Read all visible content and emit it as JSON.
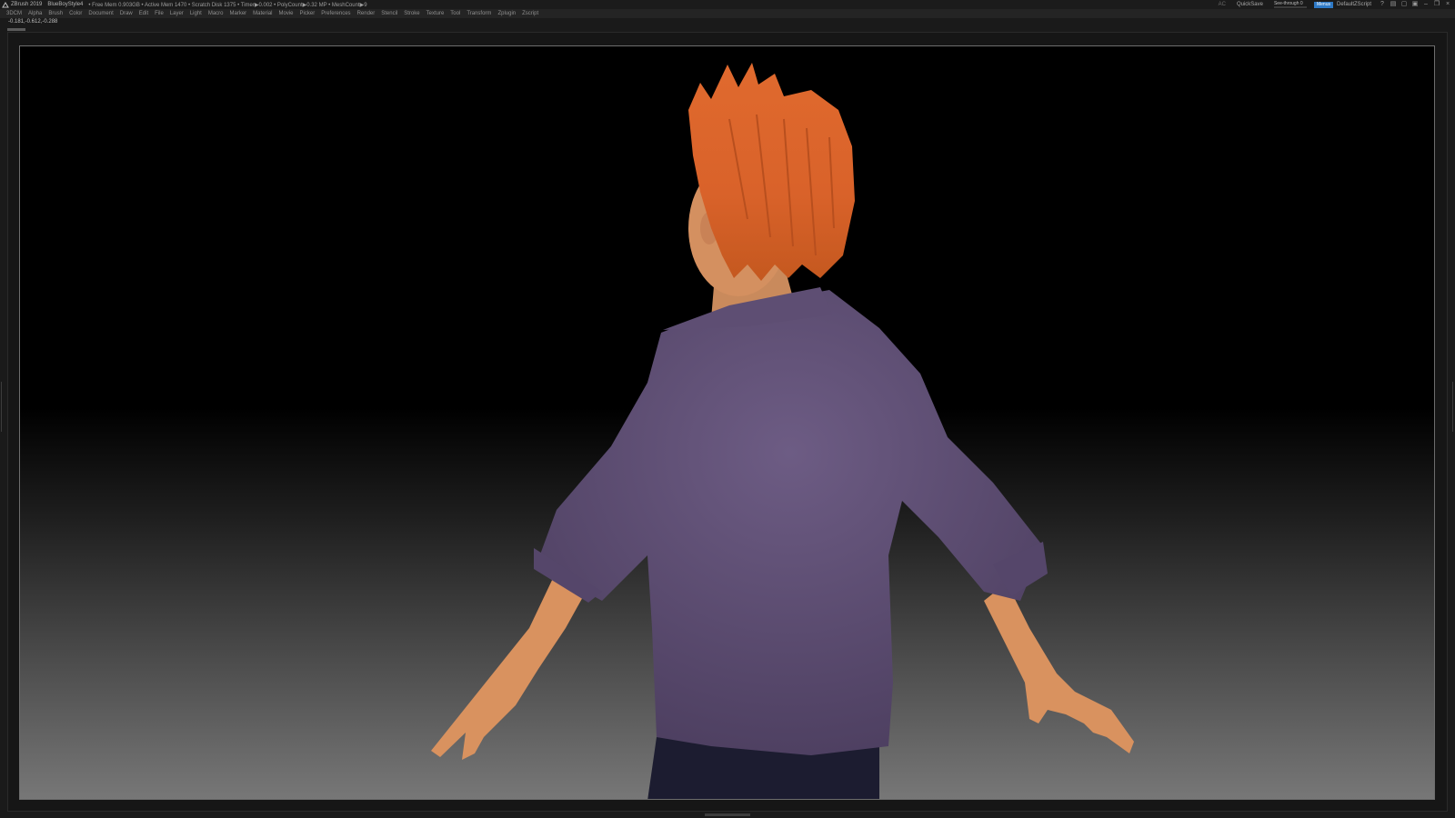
{
  "titlebar": {
    "app": "ZBrush 2019",
    "document": "BlueBoyStyle4",
    "stats": "• Free Mem 0.903GB • Active Mem 1470 • Scratch Disk 1375 • Timer▶0.002 • PolyCount▶0.32 MP • MeshCount▶9",
    "ac": "AC",
    "quicksave": "QuickSave",
    "see_through": "See-through  0",
    "see_through_level": 0,
    "menus_button": "Menus",
    "script": "DefaultZScript",
    "icons": [
      "help-icon",
      "layout-icon",
      "maximize-icon",
      "lock-icon",
      "minimize-icon",
      "restore-icon",
      "close-icon"
    ]
  },
  "menubar": [
    "3DCM",
    "Alpha",
    "Brush",
    "Color",
    "Document",
    "Draw",
    "Edit",
    "File",
    "Layer",
    "Light",
    "Macro",
    "Marker",
    "Material",
    "Movie",
    "Picker",
    "Preferences",
    "Render",
    "Stencil",
    "Stroke",
    "Texture",
    "Tool",
    "Transform",
    "Zplugin",
    "Zscript"
  ],
  "coords": "-0.181,-0.612,-0.288",
  "colors": {
    "accent": "#2e79c5",
    "shirt": "#5a4a6e",
    "skin": "#d9925f",
    "hair": "#d9622a",
    "pants": "#1c1c30"
  }
}
